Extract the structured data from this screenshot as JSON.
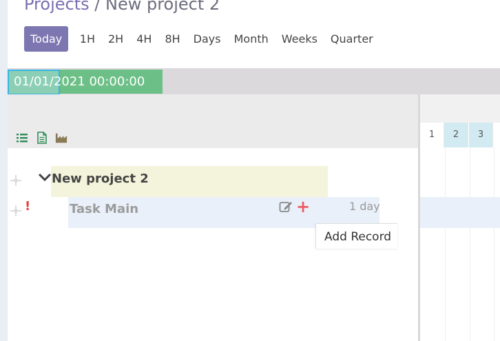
{
  "breadcrumb": {
    "parent": "Projects",
    "separator": "/",
    "current": "New project 2"
  },
  "zoom": {
    "buttons": [
      "Today",
      "1H",
      "2H",
      "4H",
      "8H",
      "Days",
      "Month",
      "Weeks",
      "Quarter"
    ],
    "active": "Today"
  },
  "timeline": {
    "start_date": "01/01/2021 00:00:00",
    "days": [
      "1",
      "2",
      "3"
    ]
  },
  "toolbar_icons": [
    "list-icon",
    "document-icon",
    "factory-icon"
  ],
  "rows": {
    "project": {
      "name": "New project 2"
    },
    "task": {
      "name": "Task Main",
      "duration": "1 day",
      "warning": "!"
    }
  },
  "tooltip": {
    "text": "Add Record"
  },
  "colors": {
    "accent": "#7c77b1",
    "project_row": "#f4f4dc",
    "task_row": "#e9f0f9",
    "date_bar": "#6cbf86",
    "weekend": "#d2ebf3",
    "warning": "#e0413e",
    "add": "#ee5a62"
  }
}
